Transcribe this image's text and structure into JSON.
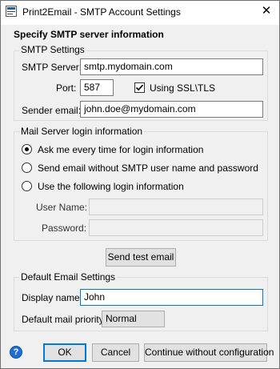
{
  "window": {
    "title": "Print2Email - SMTP Account Settings",
    "close_glyph": "✕"
  },
  "heading": "Specify SMTP server information",
  "smtp": {
    "group_title": "SMTP Settings",
    "server_label": "SMTP Server:",
    "server_value": "smtp.mydomain.com",
    "port_label": "Port:",
    "port_value": "587",
    "ssl_label": "Using SSL\\TLS",
    "ssl_checked": true,
    "sender_label": "Sender email:",
    "sender_value": "john.doe@mydomain.com"
  },
  "login": {
    "group_title": "Mail Server login information",
    "options": [
      {
        "label": "Ask me every time for login information",
        "selected": true
      },
      {
        "label": "Send email without SMTP user name and password",
        "selected": false
      },
      {
        "label": "Use the following login information",
        "selected": false
      }
    ],
    "username_label": "User Name:",
    "username_value": "",
    "password_label": "Password:",
    "password_value": ""
  },
  "test_button": "Send test email",
  "defaults": {
    "group_title": "Default Email Settings",
    "display_label": "Display name:",
    "display_value": "John",
    "priority_label": "Default mail priority:",
    "priority_value": "Normal"
  },
  "footer": {
    "help_glyph": "?",
    "ok": "OK",
    "cancel": "Cancel",
    "continue": "Continue without configuration"
  },
  "colors": {
    "accent": "#0078d7",
    "help": "#1f6fd1"
  }
}
